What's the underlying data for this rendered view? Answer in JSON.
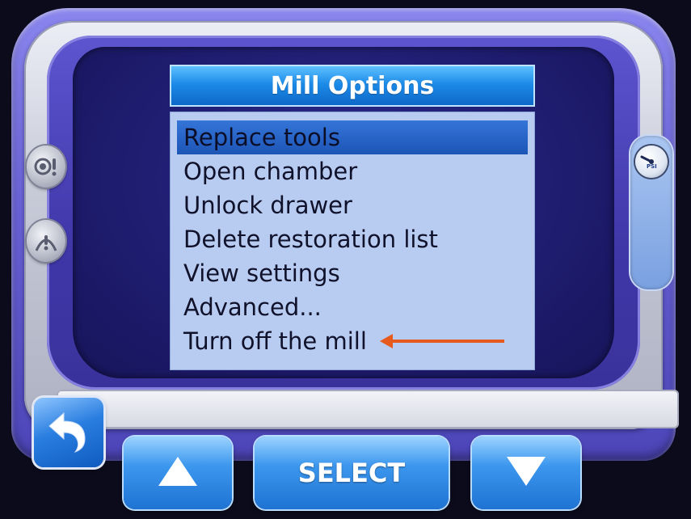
{
  "menu": {
    "title": "Mill Options",
    "items": [
      {
        "label": "Replace tools",
        "selected": true
      },
      {
        "label": "Open chamber",
        "selected": false
      },
      {
        "label": "Unlock drawer",
        "selected": false
      },
      {
        "label": "Delete restoration list",
        "selected": false
      },
      {
        "label": "View settings",
        "selected": false
      },
      {
        "label": "Advanced...",
        "selected": false
      },
      {
        "label": "Turn off the mill",
        "selected": false
      }
    ]
  },
  "gauge": {
    "label": "PSI",
    "icon": "pressure-gauge-icon"
  },
  "left_buttons": [
    {
      "icon": "sound-alert-icon"
    },
    {
      "icon": "warning-icon"
    }
  ],
  "bottom_bar": {
    "back_icon": "back-arrow-icon",
    "up_icon": "up-arrow-icon",
    "select_label": "SELECT",
    "down_icon": "down-arrow-icon"
  },
  "colors": {
    "frame": "#6a63d9",
    "screen": "#1e1c6e",
    "header": "#1d8be8",
    "list_bg": "#b8cbf0",
    "selected": "#1f5fc2",
    "annotation_arrow": "#e65a1e",
    "button": "#3c97ee"
  }
}
